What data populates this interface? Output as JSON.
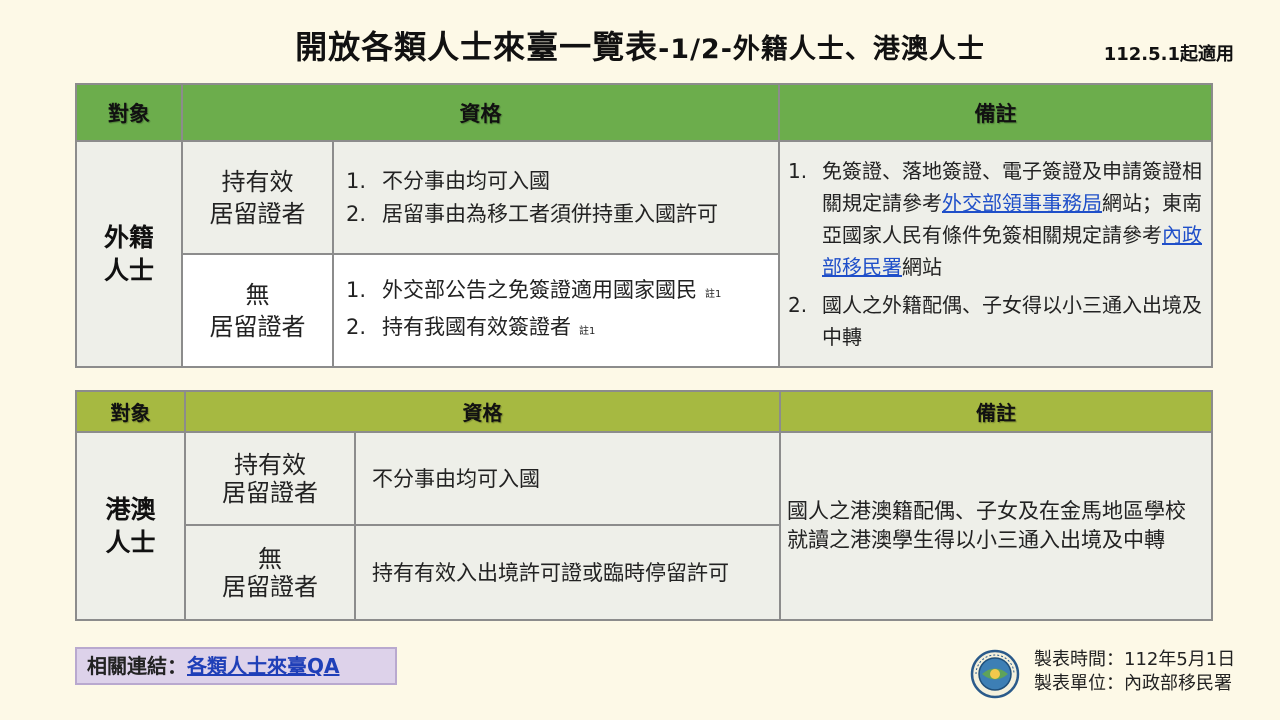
{
  "header": {
    "title_main": "開放各類人士來臺一覽表",
    "title_sub": "-1/2-外籍人士、港澳人士",
    "effective_date": "112.5.1起適用"
  },
  "table1": {
    "headers": [
      "對象",
      "資格",
      "備註"
    ],
    "subject_line1": "外籍",
    "subject_line2": "人士",
    "rows": [
      {
        "status_line1": "持有效",
        "status_line2": "居留證者",
        "items": [
          {
            "num": "1.",
            "text": "不分事由均可入國",
            "note": ""
          },
          {
            "num": "2.",
            "text": "居留事由為移工者須併持重入國許可",
            "note": ""
          }
        ]
      },
      {
        "status_line1": "無",
        "status_line2": "居留證者",
        "items": [
          {
            "num": "1.",
            "text": "外交部公告之免簽證適用國家國民",
            "note": "註1"
          },
          {
            "num": "2.",
            "text": "持有我國有效簽證者",
            "note": "註1"
          }
        ]
      }
    ],
    "remarks": {
      "r1_num": "1.",
      "r1_pre": "免簽證、落地簽證、電子簽證及申請簽證相關規定請參考",
      "r1_link1": "外交部領事事務局",
      "r1_mid": "網站；東南亞國家人民有條件免簽相關規定請參考",
      "r1_link2": "內政部移民署",
      "r1_post": "網站",
      "r2_num": "2.",
      "r2_text": "國人之外籍配偶、子女得以小三通入出境及中轉"
    }
  },
  "table2": {
    "headers": [
      "對象",
      "資格",
      "備註"
    ],
    "subject_line1": "港澳",
    "subject_line2": "人士",
    "rows": [
      {
        "status_line1": "持有效",
        "status_line2": "居留證者",
        "text": "不分事由均可入國"
      },
      {
        "status_line1": "無",
        "status_line2": "居留證者",
        "text": "持有有效入出境許可證或臨時停留許可"
      }
    ],
    "remark": "國人之港澳籍配偶、子女及在金馬地區學校就讀之港澳學生得以小三通入出境及中轉"
  },
  "footer": {
    "related_label": "相關連結：",
    "related_link": "各類人士來臺QA",
    "made_time": "製表時間：112年5月1日",
    "made_unit": "製表單位：內政部移民署"
  },
  "colors": {
    "background": "#fdf9e7",
    "table1_header": "#6cad4c",
    "table2_header": "#a6b941",
    "link": "#1f4fc9",
    "related_box": "#ddd2ea"
  },
  "icons": {
    "seal": "immigration-agency-seal-icon"
  }
}
